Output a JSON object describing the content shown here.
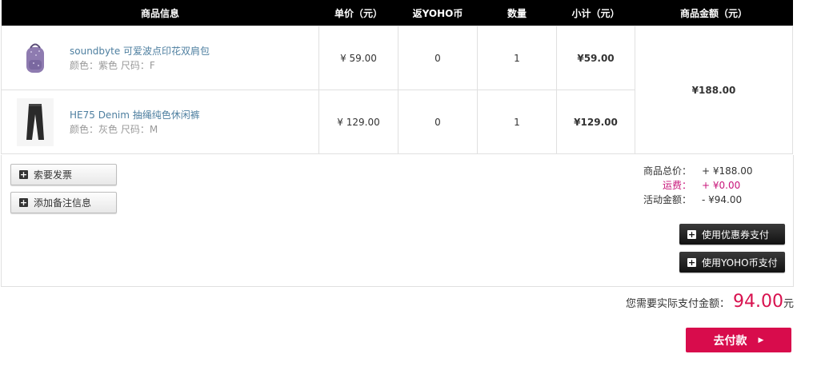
{
  "table": {
    "headers": [
      "商品信息",
      "单价（元）",
      "返YOHO币",
      "数量",
      "小计（元）",
      "商品金额（元）"
    ],
    "items": [
      {
        "name": "soundbyte 可爱波点印花双肩包",
        "attrs": "颜色：紫色 尺码：F",
        "price": "¥ 59.00",
        "coins": "0",
        "qty": "1",
        "subtotal": "¥59.00",
        "thumb_icon": "backpack-icon"
      },
      {
        "name": "HE75 Denim 抽绳纯色休闲裤",
        "attrs": "颜色：灰色 尺码：M",
        "price": "¥ 129.00",
        "coins": "0",
        "qty": "1",
        "subtotal": "¥129.00",
        "thumb_icon": "pants-icon"
      }
    ],
    "goods_total": "¥188.00"
  },
  "actions": {
    "invoice": "索要发票",
    "remark": "添加备注信息",
    "coupon": "使用优惠券支付",
    "yoho_coin": "使用YOHO币支付"
  },
  "summary": {
    "goods_total_label": "商品总价：",
    "goods_total_value": "+ ¥188.00",
    "shipping_label": "运费：",
    "shipping_value": "+ ¥0.00",
    "discount_label": "活动金额：",
    "discount_value": "- ¥94.00"
  },
  "payment": {
    "label": "您需要实际支付金额：",
    "amount": "94.00",
    "unit": "元",
    "pay_button": "去付款",
    "accent_color": "#d80c4c"
  }
}
